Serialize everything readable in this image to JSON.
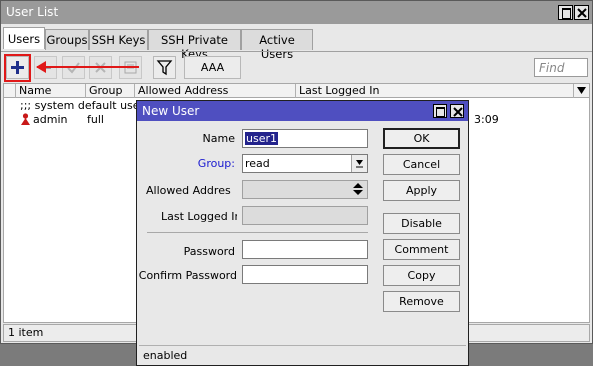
{
  "window": {
    "title": "User List"
  },
  "tabs": [
    "Users",
    "Groups",
    "SSH Keys",
    "SSH Private Keys",
    "Active Users"
  ],
  "toolbar": {
    "aaa_label": "AAA",
    "find_placeholder": "Find"
  },
  "table": {
    "columns": [
      "Name",
      "Group",
      "Allowed Address",
      "Last Logged In"
    ],
    "comment_row": ";;; system default user",
    "rows": [
      {
        "name": "admin",
        "group": "full",
        "allowed_address": "",
        "last_logged_in": "3:09"
      }
    ]
  },
  "status": {
    "item_count": "1 item"
  },
  "dialog": {
    "title": "New User",
    "fields": {
      "name_label": "Name",
      "name_value": "user1",
      "group_label": "Group:",
      "group_value": "read",
      "allowed_address_label": "Allowed Addres",
      "last_logged_in_label": "Last Logged In",
      "password_label": "Password",
      "confirm_password_label": "Confirm Password"
    },
    "buttons": [
      "OK",
      "Cancel",
      "Apply",
      "Disable",
      "Comment",
      "Copy",
      "Remove"
    ],
    "status": "enabled"
  },
  "colors": {
    "dialog_title": "#4f4fc0",
    "highlight": "#e01818",
    "link_label": "#1a1ad0"
  },
  "icons": [
    "plus-icon",
    "minus-icon",
    "check-icon",
    "x-icon",
    "note-icon",
    "filter-icon",
    "arrow-left-icon",
    "admin-user-icon",
    "close-icon",
    "maximize-icon",
    "chevron-down-icon"
  ]
}
